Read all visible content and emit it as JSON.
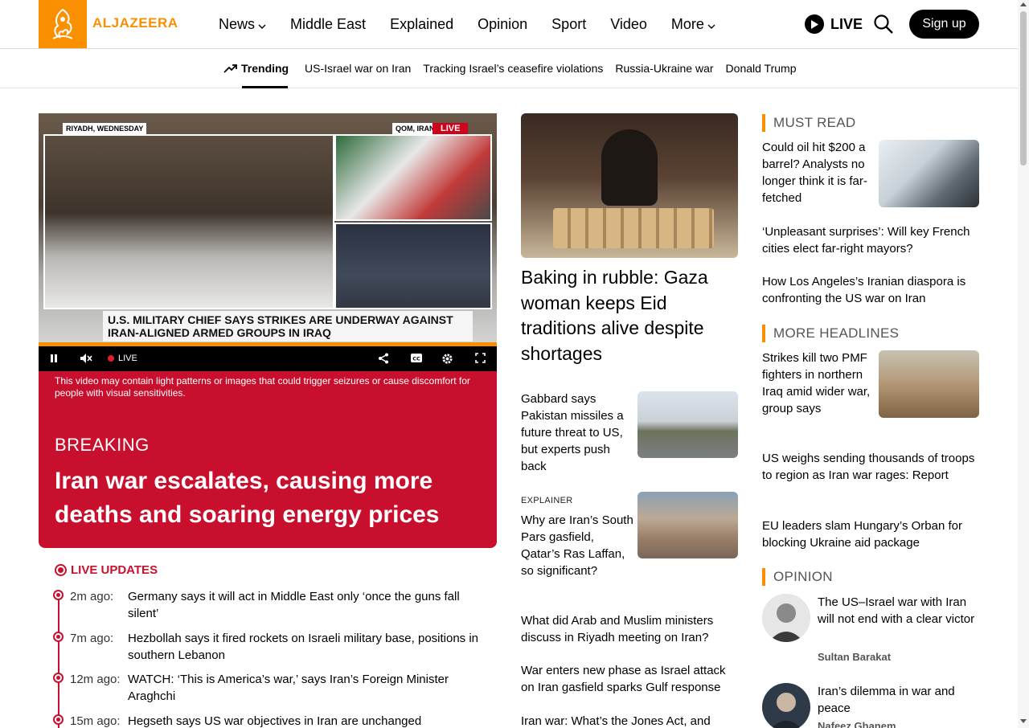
{
  "header": {
    "logo_text": "ALJAZEERA",
    "nav": [
      {
        "label": "News",
        "has_menu": true
      },
      {
        "label": "Middle East",
        "has_menu": false
      },
      {
        "label": "Explained",
        "has_menu": false
      },
      {
        "label": "Opinion",
        "has_menu": false
      },
      {
        "label": "Sport",
        "has_menu": false
      },
      {
        "label": "Video",
        "has_menu": false
      },
      {
        "label": "More",
        "has_menu": true
      }
    ],
    "live_label": "LIVE",
    "signup_label": "Sign up"
  },
  "trending": {
    "label": "Trending",
    "links": [
      "US-Israel war on Iran",
      "Tracking Israel’s ceasefire violations",
      "Russia-Ukraine war",
      "Donald Trump"
    ]
  },
  "video": {
    "tag_left": "RIYADH, WEDNESDAY",
    "tag_right": "QOM, IRAN",
    "tag_live": "LIVE",
    "lower_third": "U.S. MILITARY CHIEF SAYS STRIKES ARE UNDERWAY AGAINST IRAN-ALIGNED ARMED GROUPS IN IRAQ",
    "controls_live": "LIVE",
    "warning": "This video may contain light patterns or images that could trigger seizures or cause discomfort for people with visual sensitivities."
  },
  "breaking": {
    "label": "BREAKING",
    "headline": "Iran war escalates, causing more deaths and soaring energy prices"
  },
  "live_updates": {
    "label": "LIVE UPDATES",
    "items": [
      {
        "time": "2m ago:",
        "text": "Germany says it will act in Middle East only ‘once the guns fall silent’"
      },
      {
        "time": "7m ago:",
        "text": "Hezbollah says it fired rockets on Israeli military base, positions in southern Lebanon"
      },
      {
        "time": "12m ago:",
        "text": "WATCH: ‘This is America’s war,’ says Iran’s Foreign Minister Araghchi"
      },
      {
        "time": "15m ago:",
        "text": "Hegseth says US war objectives in Iran are unchanged"
      }
    ]
  },
  "middle": {
    "lead_headline": "Baking in rubble: Gaza woman keeps Eid traditions alive despite shortages",
    "stories": [
      {
        "title": "Gabbard says Pakistan missiles a future threat to US, but experts push back"
      },
      {
        "eyebrow": "EXPLAINER",
        "title": "Why are Iran’s South Pars gasfield, Qatar’s Ras Laffan, so significant?"
      }
    ],
    "list": [
      "What did Arab and Muslim ministers discuss in Riyadh meeting on Iran?",
      "War enters new phase as Israel attack on Iran gasfield sparks Gulf response",
      "Iran war: What’s the Jones Act, and"
    ]
  },
  "right": {
    "must_read": {
      "label": "MUST READ",
      "items": [
        "Could oil hit $200 a barrel? Analysts no longer think it is far-fetched",
        "‘Unpleasant surprises’: Will key French cities elect far-right mayors?",
        "How Los Angeles’s Iranian diaspora is confronting the US war on Iran"
      ]
    },
    "more_headlines": {
      "label": "MORE HEADLINES",
      "items": [
        "Strikes kill two PMF fighters in northern Iraq amid wider war, group says",
        "US weighs sending thousands of troops to region as Iran war rages: Report",
        "EU leaders slam Hungary’s Orban for blocking Ukraine aid package"
      ]
    },
    "opinion": {
      "label": "OPINION",
      "items": [
        {
          "title": "The US–Israel war with Iran will not end with a clear victor",
          "author": "Sultan Barakat"
        },
        {
          "title": "Iran’s dilemma in war and peace",
          "author": "Nafeez Ghanem"
        }
      ]
    }
  },
  "colors": {
    "brand_orange": "#fa9000",
    "breaking_red": "#c8102e"
  }
}
